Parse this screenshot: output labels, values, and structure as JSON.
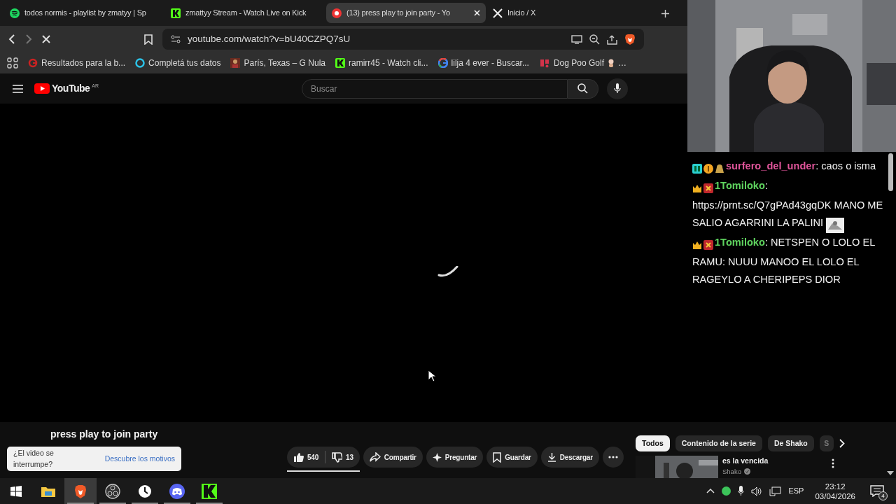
{
  "browser": {
    "tabs": [
      {
        "title": "todos normis - playlist by zmatyy | Sp",
        "kind": "spotify",
        "selected": false
      },
      {
        "title": "zmattyy Stream - Watch Live on Kick",
        "kind": "kick",
        "selected": false
      },
      {
        "title": "(13) press play to join party - Yo",
        "kind": "youtube",
        "selected": true
      },
      {
        "title": "Inicio / X",
        "kind": "x",
        "selected": false
      }
    ],
    "address": "youtube.com/watch?v=bU40CZPQ7sU",
    "bookmarks": [
      {
        "title": "Resultados para la b...",
        "kind": "red-g"
      },
      {
        "title": "Completá tus datos",
        "kind": "ring"
      },
      {
        "title": "París, Texas – G Nula"
      },
      {
        "title": "ramirr45 - Watch cli...",
        "kind": "kick"
      },
      {
        "title": "lilja 4 ever - Buscar...",
        "kind": "google"
      },
      {
        "title": "Dog Poo Golf",
        "kind": "dog",
        "suffix": "…"
      }
    ]
  },
  "youtube": {
    "logo_text": "YouTube",
    "region": "AR",
    "search_placeholder": "Buscar",
    "video_title": "press play to join party",
    "notice": {
      "text": "¿El video se interrumpe?",
      "link": "Descubre los motivos"
    },
    "actions": [
      {
        "label": "540",
        "kind": "like"
      },
      {
        "label": "13",
        "kind": "dislike"
      },
      {
        "label": "Compartir",
        "kind": "share"
      },
      {
        "label": "Preguntar",
        "kind": "ask"
      },
      {
        "label": "Guardar",
        "kind": "save"
      },
      {
        "label": "Descargar",
        "kind": "download"
      },
      {
        "kind": "more"
      }
    ],
    "chips": [
      {
        "label": "Todos",
        "selected": true
      },
      {
        "label": "Contenido de la serie",
        "selected": false
      },
      {
        "label": "De Shako",
        "selected": false
      },
      {
        "label": "S",
        "selected": false
      }
    ],
    "recommendation": {
      "title": "es la vencida",
      "channel": "Shako"
    }
  },
  "chat": {
    "messages": [
      {
        "kind": "bits",
        "user": "surfero_del_under",
        "color": "#e0559a",
        "text": ": caos o isma"
      },
      {
        "kind": "crown",
        "user": "1Tomiloko",
        "color": "#5fd35f",
        "text": ": https://prnt.sc/Q7gPAd43gqDK MANO ME SALIO AGARRINI LA PALINI",
        "emote": true
      },
      {
        "kind": "crown",
        "user": "1Tomiloko",
        "color": "#5fd35f",
        "text": ": NETSPEN O LOLO EL RAMU: NUUU MANOO EL LOLO EL RAGEYLO A CHERIPEPS DIOR"
      }
    ]
  },
  "taskbar": {
    "apps": [
      {
        "kind": "windows",
        "selected": false
      },
      {
        "kind": "folder",
        "selected": false
      },
      {
        "kind": "brave",
        "selected": true
      },
      {
        "kind": "obs",
        "selected": false
      },
      {
        "kind": "clock",
        "selected": false
      },
      {
        "kind": "discord",
        "selected": false
      },
      {
        "kind": "kick",
        "selected": false
      }
    ],
    "language": "ESP",
    "time": "23:12",
    "date": "03/04/2026",
    "notifications": "4"
  }
}
